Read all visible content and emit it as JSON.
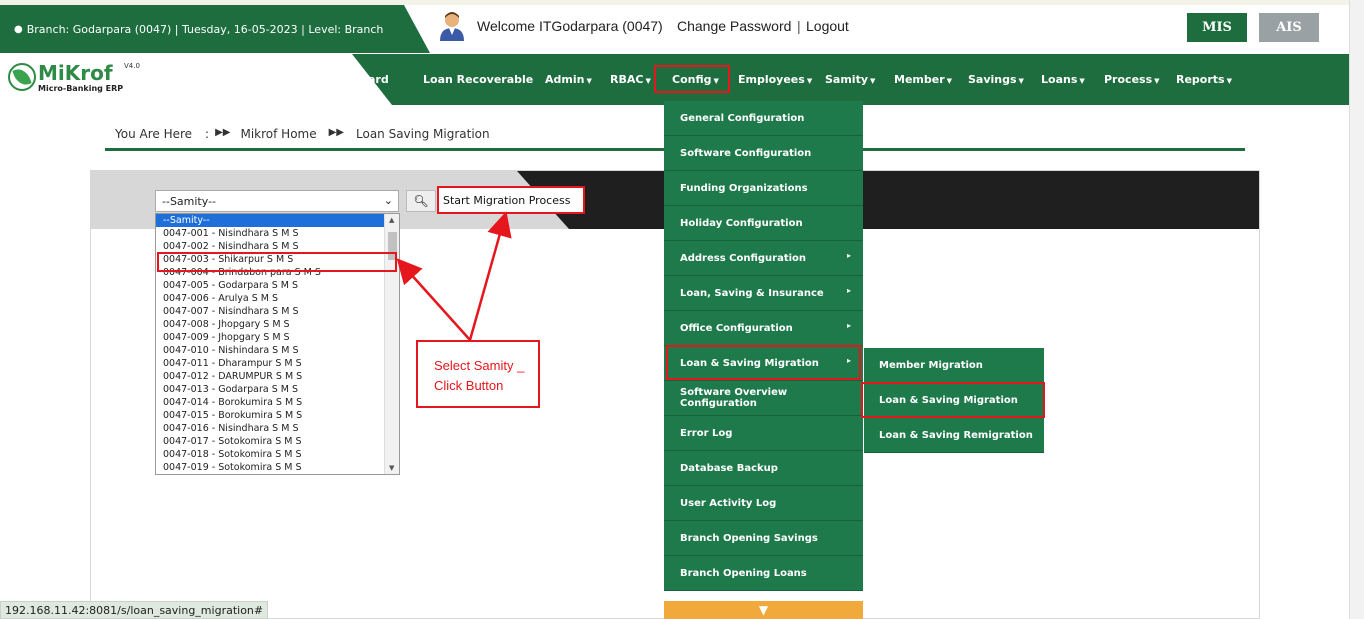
{
  "header": {
    "branch_info": "Branch: Godarpara (0047) | Tuesday, 16-05-2023 | Level: Branch",
    "welcome": "Welcome ITGodarpara (0047)",
    "change_password": "Change Password",
    "separator": "|",
    "logout": "Logout",
    "mis_label": "MIS",
    "ais_label": "AIS"
  },
  "logo": {
    "name": "MiKrof",
    "version": "V4.0",
    "subtitle": "Micro-Banking ERP"
  },
  "nav": {
    "items": [
      {
        "label": "ard"
      },
      {
        "label": "Loan Recoverable"
      },
      {
        "label": "Admin"
      },
      {
        "label": "RBAC"
      },
      {
        "label": "Config"
      },
      {
        "label": "Employees"
      },
      {
        "label": "Samity"
      },
      {
        "label": "Member"
      },
      {
        "label": "Savings"
      },
      {
        "label": "Loans"
      },
      {
        "label": "Process"
      },
      {
        "label": "Reports"
      }
    ]
  },
  "breadcrumb": {
    "prefix": "You Are Here",
    "colon": ":",
    "home": "Mikrof Home",
    "current": "Loan Saving Migration"
  },
  "form": {
    "select_value": "--Samity--",
    "start_button": "Start Migration Process",
    "options": [
      "--Samity--",
      "0047-001 - Nisindhara S M S",
      "0047-002 - Nisindhara S M S",
      "0047-003 - Shikarpur S M S",
      "0047-004 - Brindabon para S M S",
      "0047-005 - Godarpara S M S",
      "0047-006 - Arulya S M S",
      "0047-007 - Nisindhara S M S",
      "0047-008 - Jhopgary S M S",
      "0047-009 - Jhopgary S M S",
      "0047-010 - Nishindara S M S",
      "0047-011 - Dharampur S M S",
      "0047-012 - DARUMPUR S M S",
      "0047-013 - Godarpara S M S",
      "0047-014 - Borokumira S M S",
      "0047-015 - Borokumira S M S",
      "0047-016 - Nisindhara S M S",
      "0047-017 - Sotokomira S M S",
      "0047-018 - Sotokomira S M S",
      "0047-019 - Sotokomira S M S"
    ]
  },
  "annotation": {
    "line1": "Select Samity _",
    "line2": "Click Button"
  },
  "config_menu": {
    "items": [
      {
        "label": "General Configuration",
        "has_sub": false
      },
      {
        "label": "Software Configuration",
        "has_sub": false
      },
      {
        "label": "Funding Organizations",
        "has_sub": false
      },
      {
        "label": "Holiday Configuration",
        "has_sub": false
      },
      {
        "label": "Address Configuration",
        "has_sub": true
      },
      {
        "label": "Loan, Saving & Insurance",
        "has_sub": true
      },
      {
        "label": "Office Configuration",
        "has_sub": true
      },
      {
        "label": "Loan & Saving Migration",
        "has_sub": true
      },
      {
        "label": "Software Overview Configuration",
        "has_sub": false
      },
      {
        "label": "Error Log",
        "has_sub": false
      },
      {
        "label": "Database Backup",
        "has_sub": false
      },
      {
        "label": "User Activity Log",
        "has_sub": false
      },
      {
        "label": "Branch Opening Savings",
        "has_sub": false
      },
      {
        "label": "Branch Opening Loans",
        "has_sub": false
      }
    ]
  },
  "sub_menu": {
    "items": [
      {
        "label": "Member Migration"
      },
      {
        "label": "Loan & Saving Migration"
      },
      {
        "label": "Loan & Saving Remigration"
      }
    ]
  },
  "status_bar": {
    "url": "192.168.11.42:8081/s/loan_saving_migration#"
  },
  "colors": {
    "brand_green": "#1d6d3f",
    "menu_green": "#1f7a4b",
    "highlight_red": "#e5161c",
    "accent_orange": "#f2a93b"
  }
}
